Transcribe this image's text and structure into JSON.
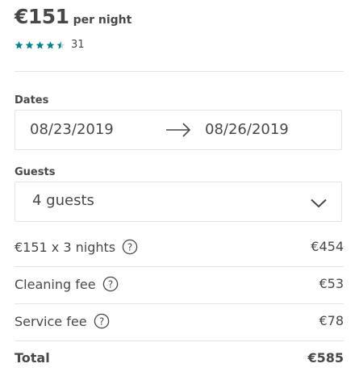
{
  "listing": {
    "price": "€151",
    "per_night": "per night",
    "rating_stars": 4.5,
    "review_count": "31",
    "star_color": "#008489"
  },
  "dates": {
    "label": "Dates",
    "check_in": "08/23/2019",
    "check_out": "08/26/2019",
    "arrow_icon": "arrow-right-icon"
  },
  "guests": {
    "label": "Guests",
    "value": "4 guests",
    "dropdown_icon": "chevron-down-icon"
  },
  "price_breakdown": {
    "nightly": {
      "label": "€151 x 3 nights",
      "amount": "€454",
      "icon": "question-circle-icon"
    },
    "cleaning": {
      "label": "Cleaning fee",
      "amount": "€53",
      "icon": "question-circle-icon"
    },
    "service": {
      "label": "Service fee",
      "amount": "€78",
      "icon": "question-circle-icon"
    },
    "total": {
      "label": "Total",
      "amount": "€585"
    }
  }
}
